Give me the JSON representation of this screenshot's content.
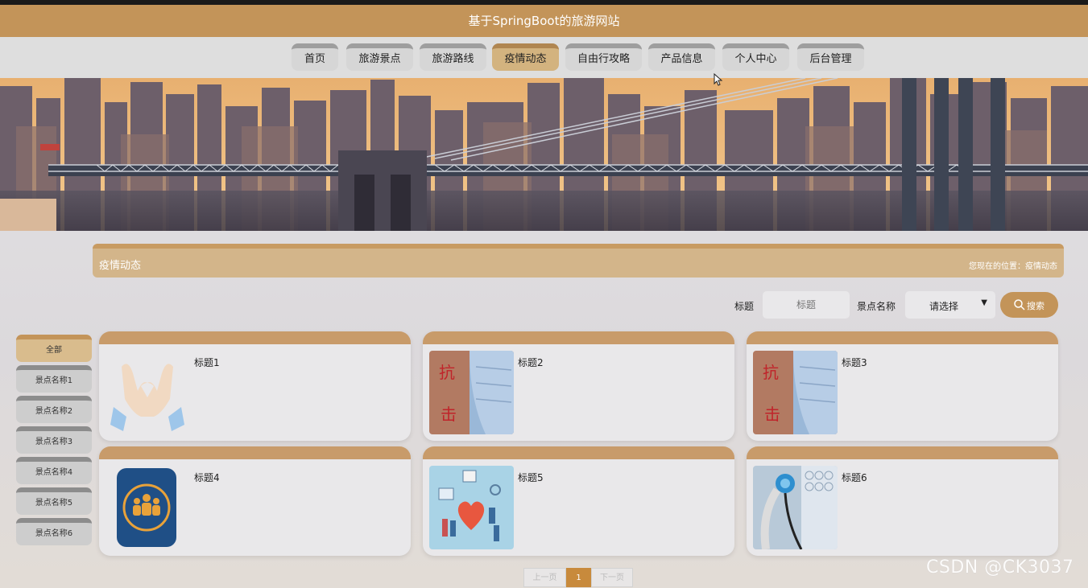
{
  "site": {
    "title": "基于SpringBoot的旅游网站"
  },
  "nav": {
    "items": [
      {
        "label": "首页"
      },
      {
        "label": "旅游景点"
      },
      {
        "label": "旅游路线"
      },
      {
        "label": "疫情动态",
        "active": true
      },
      {
        "label": "自由行攻略"
      },
      {
        "label": "产品信息"
      },
      {
        "label": "个人中心"
      },
      {
        "label": "后台管理"
      }
    ]
  },
  "section": {
    "title": "疫情动态",
    "breadcrumb": "您现在的位置：疫情动态"
  },
  "search": {
    "title_label": "标题",
    "title_placeholder": "标题",
    "spot_label": "景点名称",
    "spot_select_value": "请选择",
    "button_label": "搜索"
  },
  "sidebar": {
    "items": [
      {
        "label": "全部",
        "active": true
      },
      {
        "label": "景点名称1"
      },
      {
        "label": "景点名称2"
      },
      {
        "label": "景点名称3"
      },
      {
        "label": "景点名称4"
      },
      {
        "label": "景点名称5"
      },
      {
        "label": "景点名称6"
      }
    ]
  },
  "cards": [
    {
      "title": "标题1",
      "image": "heart-hands-illustration"
    },
    {
      "title": "标题2",
      "image": "mask-antiepidemic-photo"
    },
    {
      "title": "标题3",
      "image": "mask-antiepidemic-photo"
    },
    {
      "title": "标题4",
      "image": "family-badge-icon"
    },
    {
      "title": "标题5",
      "image": "medical-care-illustration"
    },
    {
      "title": "标题6",
      "image": "stethoscope-photo"
    }
  ],
  "pagination": {
    "prev_label": "上一页",
    "current_page": "1",
    "next_label": "下一页"
  },
  "watermark": "CSDN @CK3037",
  "colors": {
    "brand": "#c39459",
    "active_tab": "#d3b37f",
    "page_current": "#c88a3c"
  }
}
